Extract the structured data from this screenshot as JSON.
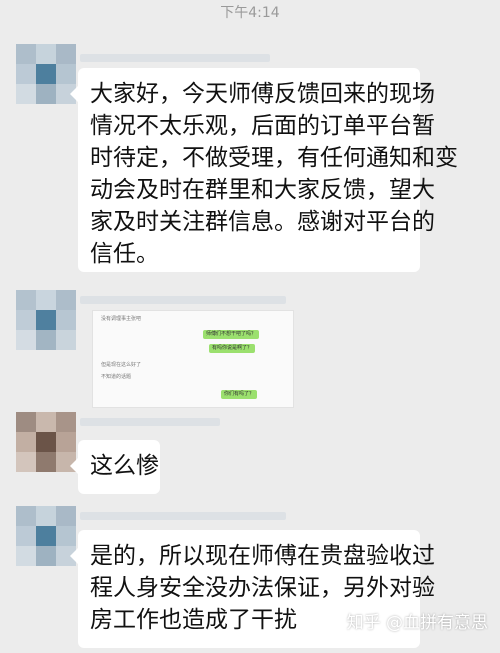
{
  "status": {
    "time": "下午4:14"
  },
  "messages": [
    {
      "type": "text",
      "lines": [
        "大家好，今天师傅反馈回来的现场",
        "情况不太乐观，后面的订单平台暂",
        "时待定，不做受理，有任何通知和变",
        "动会及时在群里和大家反馈，望大",
        "家及时关注群信息。感谢对平台的",
        "信任。"
      ]
    },
    {
      "type": "image",
      "lines": [
        "没有调理事主张吧",
        "师傅们不想干吧了吗？",
        "有吗你说是啊了？",
        "但是现在这么好了",
        "不知道的话题",
        "你们有吗了？"
      ]
    },
    {
      "type": "text",
      "lines": [
        "这么惨"
      ]
    },
    {
      "type": "text",
      "lines": [
        "是的，所以现在师傅在贵盘验收过",
        "程人身安全没办法保证，另外对验",
        "房工作也造成了干扰"
      ]
    }
  ],
  "watermark": "知乎 @血拼有意思",
  "colors": {
    "background": "#ececec",
    "bubble": "#ffffff",
    "sent_bubble": "#9be06e",
    "time_text": "#9a9a9a"
  }
}
